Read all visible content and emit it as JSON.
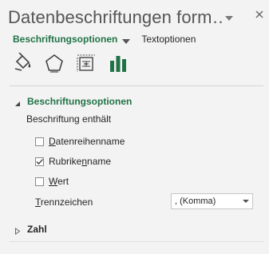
{
  "pane": {
    "title": "Datenbeschriftungen form…",
    "title_dropdown_icon": "chevron-down-icon",
    "close_icon": "close-icon"
  },
  "subnav": {
    "active_tab": "Beschriftungsoptionen",
    "other_tab": "Textoptionen"
  },
  "icons": [
    {
      "name": "fill-line-icon"
    },
    {
      "name": "effects-pentagon-icon"
    },
    {
      "name": "size-properties-icon"
    },
    {
      "name": "label-options-chart-icon",
      "selected": true
    }
  ],
  "section": {
    "title": "Beschriftungsoptionen",
    "contains_label": "Beschriftung enthält",
    "checkboxes": [
      {
        "label_pre": "",
        "label_acc": "D",
        "label_post": "atenreihenname",
        "checked": false
      },
      {
        "label_pre": "Rubrike",
        "label_acc": "n",
        "label_post": "name",
        "checked": true
      },
      {
        "label_pre": "",
        "label_acc": "W",
        "label_post": "ert",
        "checked": false
      }
    ],
    "separator_label_acc": "T",
    "separator_label_post": "rennzeichen",
    "separator_value": ", (Komma)"
  },
  "collapsed_section": {
    "title": "Zahl"
  },
  "colors": {
    "accent": "#217346",
    "background": "#f3f3f3"
  }
}
